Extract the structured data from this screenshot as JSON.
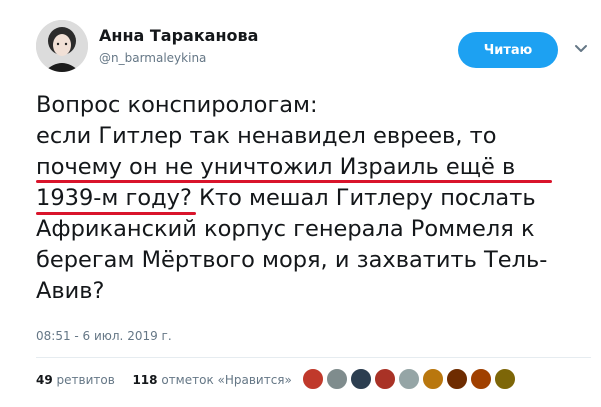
{
  "author": {
    "name": "Анна Тараканова",
    "handle": "@n_barmaleykina"
  },
  "follow_button": {
    "label": "Читаю"
  },
  "tweet": {
    "lines": [
      "Вопрос конспирологам:",
      "если Гитлер так ненавидел евреев, то",
      "почему он не уничтожил Израиль ещё в",
      "1939-м году? Кто мешал Гитлеру послать",
      "Африканский корпус генерала Роммеля к",
      "берегам Мёртвого моря, и захватить Тель-",
      "Авив?"
    ],
    "timestamp": "08:51 - 6 июл. 2019 г."
  },
  "stats": {
    "retweets_count": "49",
    "retweets_label": "ретвитов",
    "likes_count": "118",
    "likes_label": "отметок «Нравится»"
  },
  "likers": [
    {
      "color": "#c0392b"
    },
    {
      "color": "#7f8c8d"
    },
    {
      "color": "#2c3e50"
    },
    {
      "color": "#a93226"
    },
    {
      "color": "#95a5a6"
    },
    {
      "color": "#b9770e"
    },
    {
      "color": "#6e2c00"
    },
    {
      "color": "#a04000"
    },
    {
      "color": "#7d6608"
    }
  ],
  "colors": {
    "accent": "#1da1f2",
    "underline": "#d9142b"
  }
}
